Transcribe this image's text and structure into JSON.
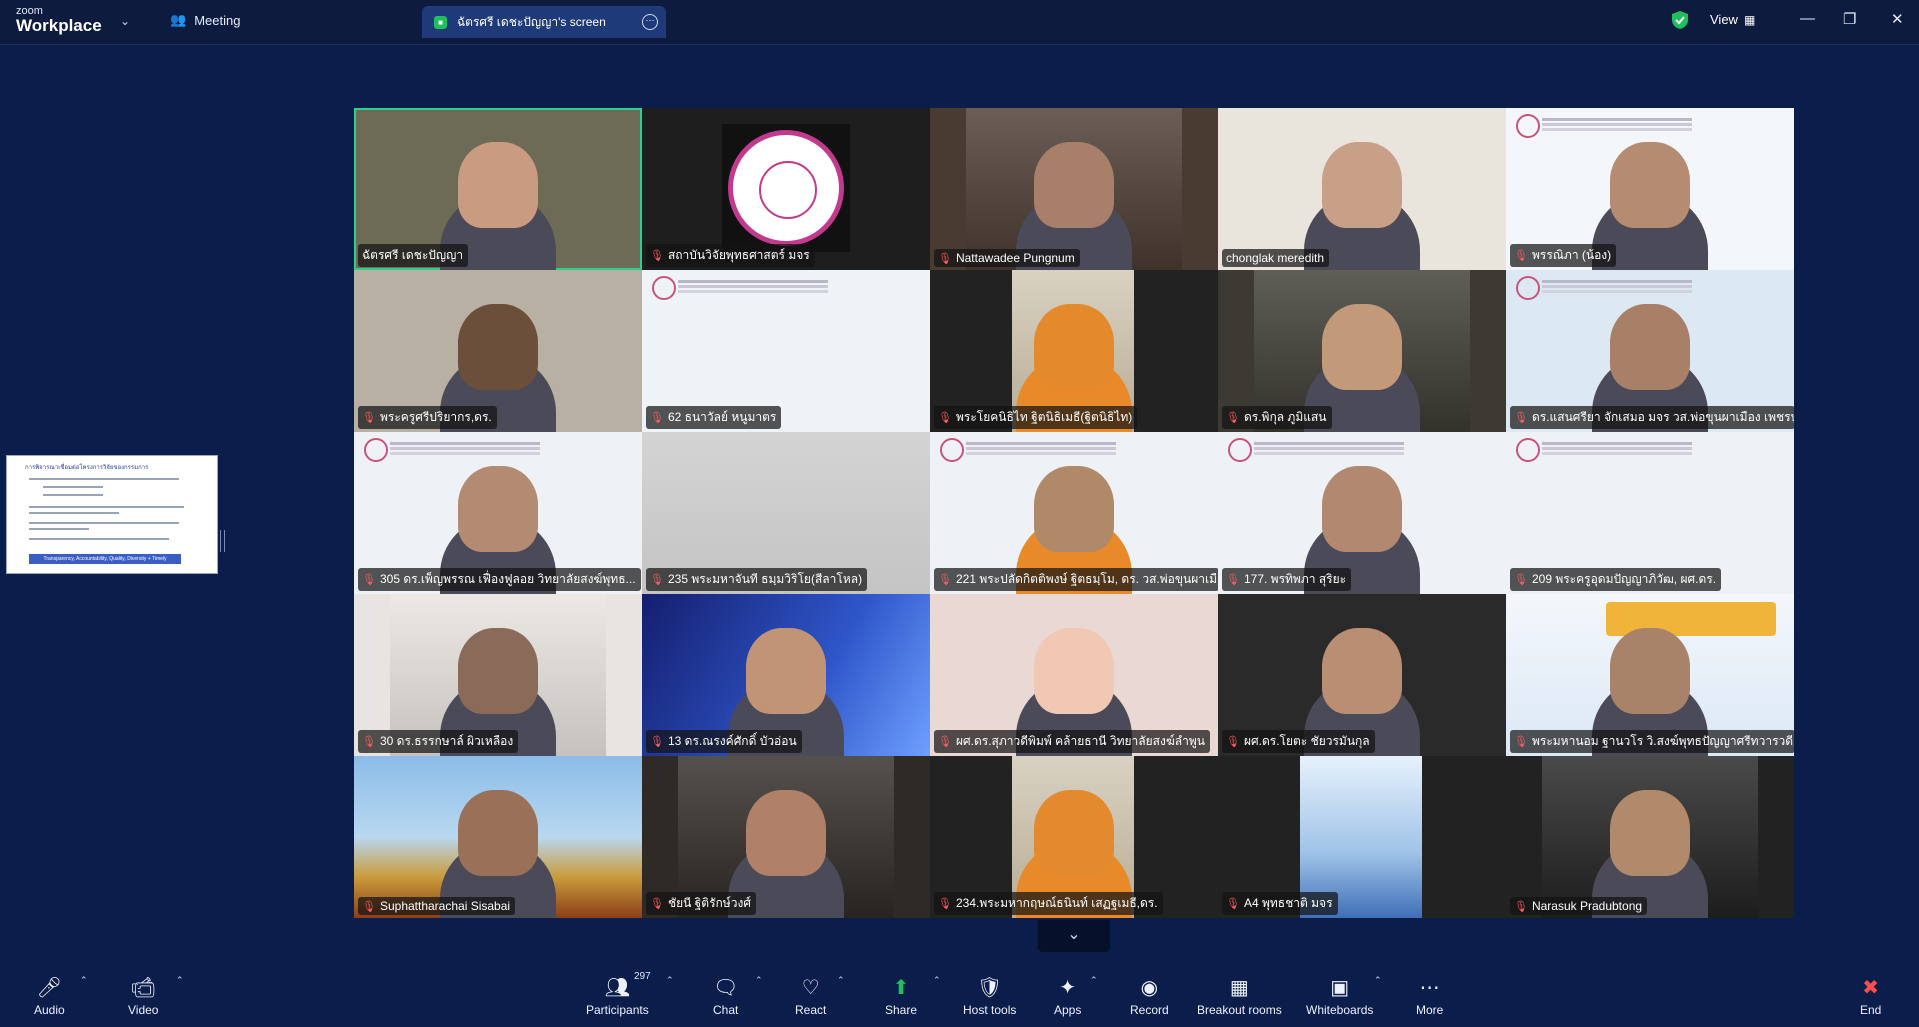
{
  "app": {
    "brand_small": "zoom",
    "brand_large": "Workplace"
  },
  "topbar": {
    "meeting_label": "Meeting",
    "screen_tab_label": "ฉัตรศรี เดชะปัญญา's screen",
    "view_label": "View"
  },
  "participants": [
    {
      "name": "ฉัตรศรี เดชะปัญญา",
      "muted": false,
      "kind": "person",
      "bg": "#6d6a55",
      "face": "#c99c82"
    },
    {
      "name": "สถาบันวิจัยพุทธศาสตร์ มจร",
      "muted": true,
      "kind": "seal",
      "bg": "#1e1e1e"
    },
    {
      "name": "Nattawadee Pungnum",
      "muted": true,
      "kind": "room",
      "bg": "#4a3b32",
      "face": "#a8806a"
    },
    {
      "name": "chonglak meredith",
      "muted": false,
      "kind": "person",
      "bg": "#e9e4dc",
      "face": "#c8a088"
    },
    {
      "name": "พรรณิภา (น้อง)",
      "muted": true,
      "kind": "slide-person",
      "bg": "#f3f6fa",
      "face": "#b58b72"
    },
    {
      "name": "พระครูศรีปริยากร,ดร.",
      "muted": true,
      "kind": "person",
      "bg": "#b8b0a2",
      "face": "#6b4f3a"
    },
    {
      "name": "62 ธนาวัลย์ หนูมาตร",
      "muted": true,
      "kind": "slide",
      "bg": "#eef3f8"
    },
    {
      "name": "พระโยคนิธิไท ฐิตนิธิเมธี(ฐิตนิธิไท)",
      "muted": true,
      "kind": "monk",
      "bg": "#222222",
      "face": "#e58a2c"
    },
    {
      "name": "ดร.พิกุล ภูมิแสน",
      "muted": true,
      "kind": "room",
      "bg": "#3d3a33",
      "face": "#c29a7a"
    },
    {
      "name": "ดร.แสนศรียา จักเสมอ มจร วส.พ่อขุนผาเมือง เพชรบู...",
      "muted": true,
      "kind": "slide-person",
      "bg": "#dde9f2",
      "face": "#a88068"
    },
    {
      "name": "305 ดร.เพ็ญพรรณ เฟื่องฟูลอย วิทยาลัยสงฆ์พุทธ...",
      "muted": true,
      "kind": "slide-person",
      "bg": "#eef2f6",
      "face": "#b38a72"
    },
    {
      "name": "235 พระมหาจันที ธมฺมวิริโย(สีลาโหล)",
      "muted": true,
      "kind": "blank",
      "bg": "#cfcfcf"
    },
    {
      "name": "221 พระปลัดกิตติพงษ์ ฐิตธมฺโม, ดร. วส.พ่อขุนผาเมือ...",
      "muted": true,
      "kind": "slide-monk",
      "bg": "#eef2f6",
      "face": "#b08a68"
    },
    {
      "name": "177. พรทิพภา สุริยะ",
      "muted": true,
      "kind": "slide-person",
      "bg": "#eef2f6",
      "face": "#b28870"
    },
    {
      "name": "209 พระครูอุดมปัญญาภิวัฒ, ผศ.ดร.",
      "muted": true,
      "kind": "slide",
      "bg": "#eef2f6"
    },
    {
      "name": "30 ดร.ธรรกษาล์ ผิวเหลือง",
      "muted": true,
      "kind": "room",
      "bg": "#e8e4df",
      "face": "#8a6a58"
    },
    {
      "name": "13 ดร.ณรงค์ศักดิ์ บัวอ่อน",
      "muted": true,
      "kind": "banner-person",
      "bg": "#1c2f8a",
      "face": "#c09474"
    },
    {
      "name": "ผศ.ดร.สุภาวดีพิมพ์ คล้ายธานี วิทยาลัยสงฆ์ลำพูน",
      "muted": true,
      "kind": "person",
      "bg": "#e9d8d4",
      "face": "#f0c8b4"
    },
    {
      "name": "ผศ.ดร.โยตะ ชัยวรมันกุล",
      "muted": true,
      "kind": "person",
      "bg": "#2a2a2a",
      "face": "#b98e72"
    },
    {
      "name": "พระมหานอม ฐานวโร วิ.สงฆ์พุทธปัญญาศรีทวารวดี",
      "muted": true,
      "kind": "poster-person",
      "bg": "#f1f5fa",
      "face": "#a9826a"
    },
    {
      "name": "Suphattharachai Sisabai",
      "muted": true,
      "kind": "temple-person",
      "bg": "#6ea6d8",
      "face": "#9a7058"
    },
    {
      "name": "ชัยนี ฐิติรักษ์วงศ์",
      "muted": true,
      "kind": "room",
      "bg": "#2f2a26",
      "face": "#b08068"
    },
    {
      "name": "234.พระมหากฤษณ์ธนินท์ เสฏฐเมธี,ดร.",
      "muted": true,
      "kind": "monk",
      "bg": "#222222",
      "face": "#e38a2e"
    },
    {
      "name": "A4 พุทธชาติ มจร",
      "muted": true,
      "kind": "poster",
      "bg": "#222222"
    },
    {
      "name": "Narasuk Pradubtong",
      "muted": true,
      "kind": "room",
      "bg": "#222222",
      "face": "#b08a6a"
    }
  ],
  "thumbnail": {
    "title": "การพิจารณาเชื่อมต่อโครงการวิจัยของกรรมการ",
    "band_text": "Transparency, Accountability, Quality, Diversity + Timely"
  },
  "toolbar": {
    "audio": "Audio",
    "video": "Video",
    "participants": "Participants",
    "participant_count": "297",
    "chat": "Chat",
    "react": "React",
    "share": "Share",
    "host_tools": "Host tools",
    "apps": "Apps",
    "record": "Record",
    "breakout_rooms": "Breakout rooms",
    "whiteboards": "Whiteboards",
    "more": "More",
    "end": "End"
  },
  "colors": {
    "background": "#0b1d4a",
    "active_speaker": "#2ccf8c",
    "share_green": "#1fbf5f",
    "end_red": "#ff4d4d",
    "muted_red": "#ff5a5a"
  }
}
